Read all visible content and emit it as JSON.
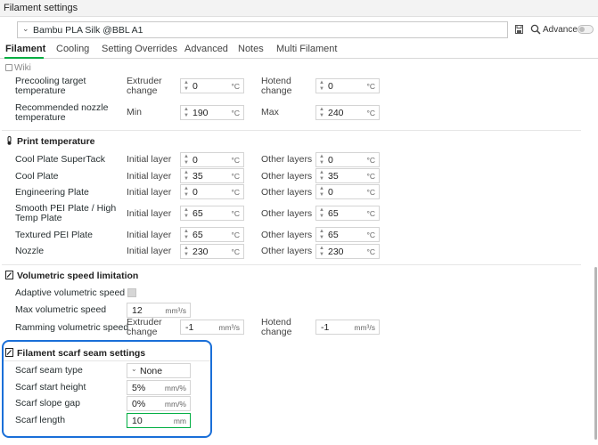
{
  "window": {
    "title": "Filament settings"
  },
  "preset": {
    "name": "Bambu PLA Silk @BBL A1",
    "advanced_label": "Advanced"
  },
  "tabs": [
    {
      "label": "Filament"
    },
    {
      "label": "Cooling"
    },
    {
      "label": "Setting Overrides"
    },
    {
      "label": "Advanced"
    },
    {
      "label": "Notes"
    },
    {
      "label": "Multi Filament"
    }
  ],
  "wiki_label": "Wiki",
  "top_rows": {
    "precool": {
      "label1": "Precooling target",
      "label2": "temperature",
      "a_label1": "Extruder",
      "a_label2": "change",
      "a_value": "0",
      "b_label1": "Hotend",
      "b_label2": "change",
      "b_value": "0",
      "unit": "°C"
    },
    "nozzle_rec": {
      "label1": "Recommended nozzle",
      "label2": "temperature",
      "a_label": "Min",
      "a_value": "190",
      "b_label": "Max",
      "b_value": "240",
      "unit": "°C"
    }
  },
  "print_temperature": {
    "title": "Print temperature",
    "col_a": "Initial layer",
    "col_b": "Other layers",
    "unit": "°C",
    "rows": [
      {
        "label": "Cool Plate SuperTack",
        "a": "0",
        "b": "0"
      },
      {
        "label": "Cool Plate",
        "a": "35",
        "b": "35"
      },
      {
        "label": "Engineering Plate",
        "a": "0",
        "b": "0"
      },
      {
        "label1": "Smooth PEI Plate / High",
        "label2": "Temp Plate",
        "a": "65",
        "b": "65"
      },
      {
        "label": "Textured PEI Plate",
        "a": "65",
        "b": "65"
      },
      {
        "label": "Nozzle",
        "a": "230",
        "b": "230"
      }
    ]
  },
  "volumetric": {
    "title": "Volumetric speed limitation",
    "adaptive_label": "Adaptive volumetric speed",
    "max_label": "Max volumetric speed",
    "max_value": "12",
    "unit": "mm³/s",
    "ramming_label": "Ramming volumetric speed",
    "ext_label1": "Extruder",
    "ext_label2": "change",
    "ext_value": "-1",
    "hot_label1": "Hotend",
    "hot_label2": "change",
    "hot_value": "-1"
  },
  "scarf": {
    "title": "Filament scarf seam settings",
    "type_label": "Scarf seam type",
    "type_value": "None",
    "start_label": "Scarf start height",
    "start_value": "5%",
    "start_unit": "mm/%",
    "gap_label": "Scarf slope gap",
    "gap_value": "0%",
    "gap_unit": "mm/%",
    "length_label": "Scarf length",
    "length_value": "10",
    "length_unit": "mm"
  },
  "colors": {
    "accent": "#00ae42",
    "highlight": "#1a6fd8"
  }
}
